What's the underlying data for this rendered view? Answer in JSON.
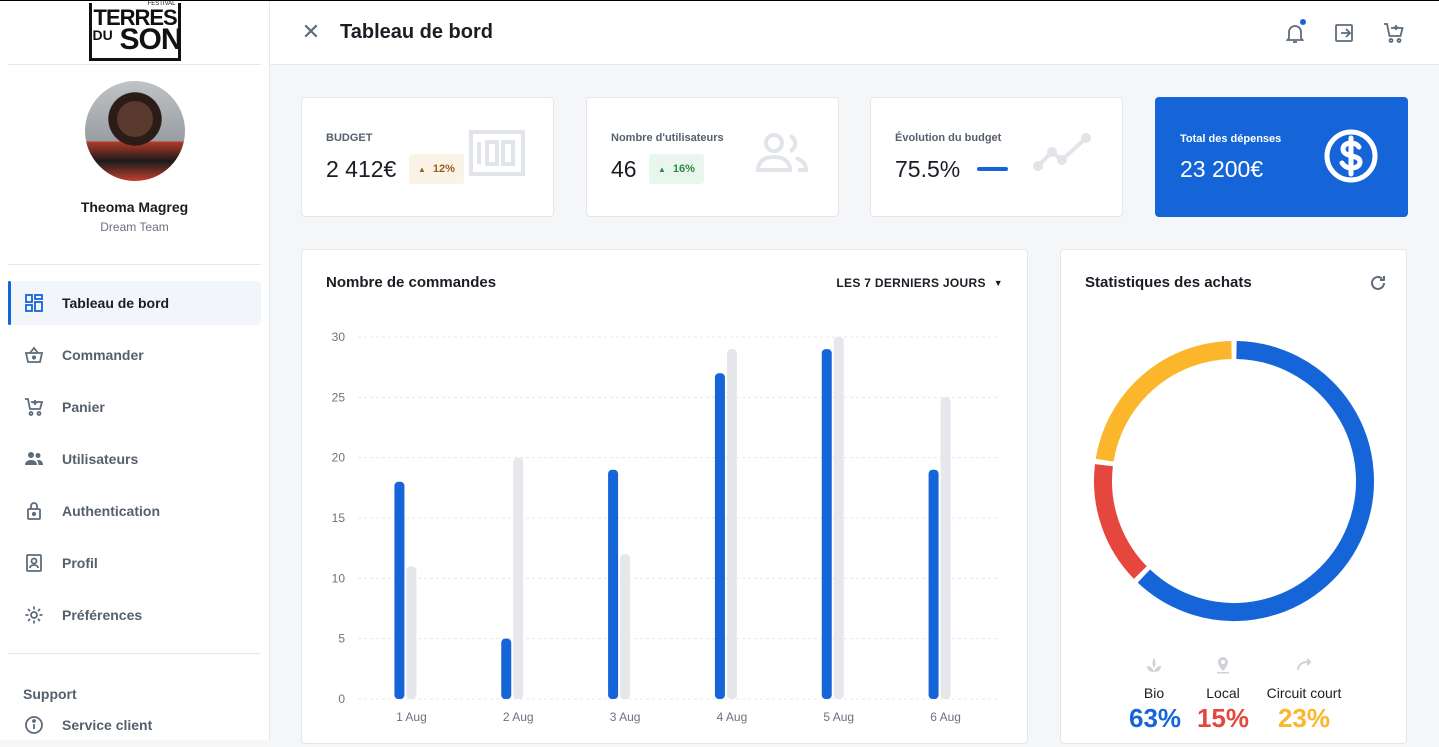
{
  "sidebar": {
    "logo": {
      "line1": "TERRES",
      "line2": "DU",
      "line3": "SON",
      "tag": "FESTIVAL"
    },
    "profile": {
      "name": "Theoma Magreg",
      "team": "Dream Team"
    },
    "nav": [
      {
        "label": "Tableau de bord",
        "icon": "dashboard-icon",
        "active": true
      },
      {
        "label": "Commander",
        "icon": "basket-icon"
      },
      {
        "label": "Panier",
        "icon": "cart-icon"
      },
      {
        "label": "Utilisateurs",
        "icon": "users-icon"
      },
      {
        "label": "Authentication",
        "icon": "lock-icon"
      },
      {
        "label": "Profil",
        "icon": "profile-icon"
      },
      {
        "label": "Préférences",
        "icon": "gear-icon"
      }
    ],
    "support": {
      "title": "Support",
      "item": {
        "label": "Service client",
        "icon": "info-icon"
      }
    }
  },
  "header": {
    "title": "Tableau de bord",
    "icons": [
      "close-icon",
      "bell-icon",
      "logout-icon",
      "cart-icon"
    ]
  },
  "cards": [
    {
      "title": "BUDGET",
      "value": "2 412€",
      "badge": "12%",
      "badge_type": "warning",
      "icon": "hundred-icon"
    },
    {
      "title": "Nombre d'utilisateurs",
      "value": "46",
      "badge": "16%",
      "badge_type": "success",
      "icon": "users-icon"
    },
    {
      "title": "Évolution du budget",
      "value": "75.5%",
      "icon": "trend-icon"
    },
    {
      "title": "Total des dépenses",
      "value": "23 200€",
      "icon": "dollar-icon"
    }
  ],
  "orders_panel": {
    "title": "Nombre de commandes",
    "period": "LES 7 DERNIERS JOURS"
  },
  "purchase_panel": {
    "title": "Statistiques des achats"
  },
  "colors": {
    "primary": "#1565d8",
    "secondary_bar": "#e5e7eb",
    "bio": "#1565d8",
    "local": "#e5463d",
    "circuit": "#fbb62b"
  },
  "chart_data": [
    {
      "type": "bar",
      "categories": [
        "1 Aug",
        "2 Aug",
        "3 Aug",
        "4 Aug",
        "5 Aug",
        "6 Aug"
      ],
      "series": [
        {
          "values": [
            18,
            5,
            19,
            27,
            29,
            19
          ],
          "color": "#1565d8"
        },
        {
          "values": [
            11,
            20,
            12,
            29,
            30,
            25
          ],
          "color": "#e5e7eb"
        }
      ],
      "yticks": [
        0,
        5,
        10,
        15,
        20,
        25,
        30
      ],
      "ylim": [
        0,
        30
      ],
      "grid": true
    },
    {
      "type": "pie",
      "labels": [
        "Bio",
        "Local",
        "Circuit court"
      ],
      "values": [
        63,
        15,
        23
      ],
      "display": [
        "63%",
        "15%",
        "23%"
      ],
      "colors": [
        "#1565d8",
        "#e5463d",
        "#fbb62b"
      ]
    }
  ]
}
